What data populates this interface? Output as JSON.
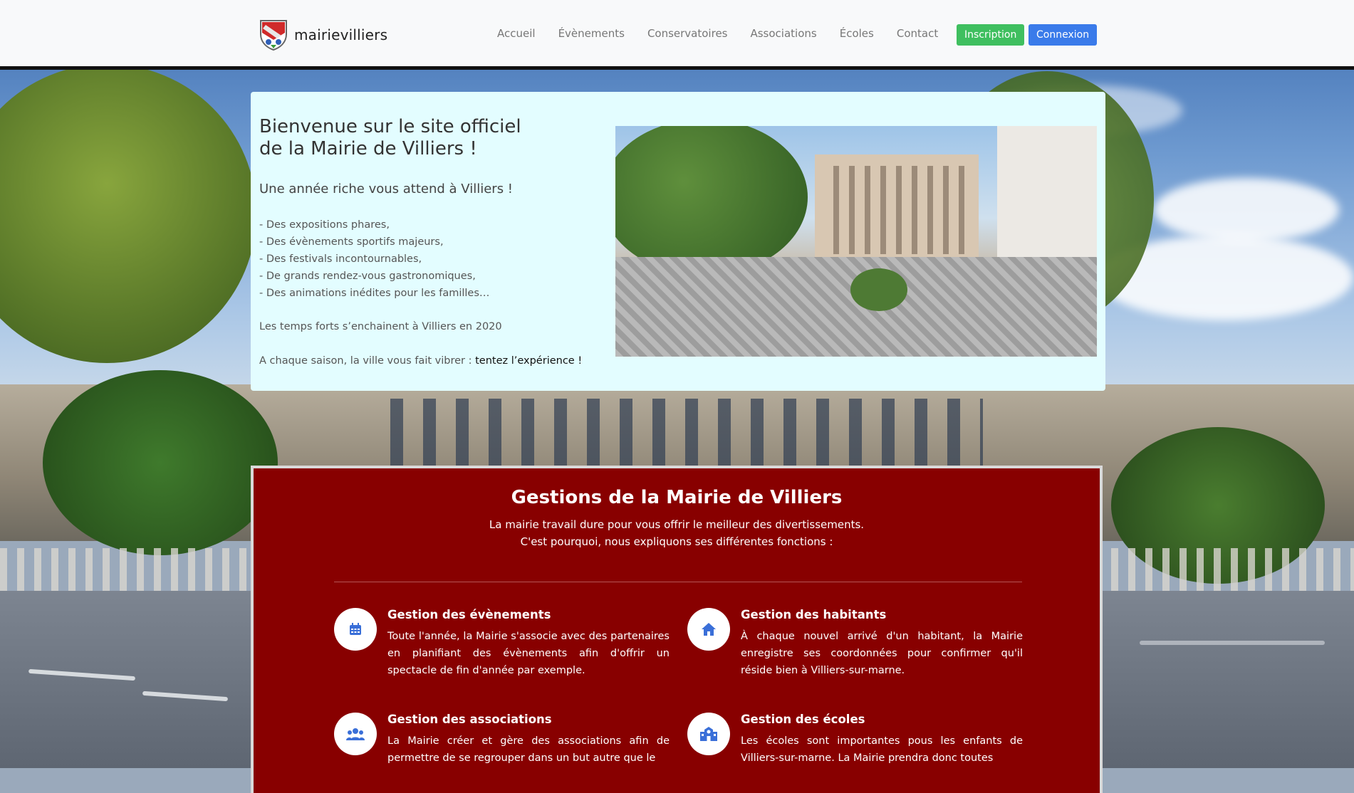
{
  "header": {
    "brand": "mairievilliers",
    "nav": [
      "Accueil",
      "Évènements",
      "Conservatoires",
      "Associations",
      "Écoles",
      "Contact"
    ],
    "btn_inscription": "Inscription",
    "btn_connexion": "Connexion"
  },
  "welcome": {
    "title_line1": "Bienvenue sur le site officiel",
    "title_line2": "de la Mairie de Villiers !",
    "lead": "Une année riche vous attend à Villiers !",
    "list": [
      "- Des expositions phares,",
      "- Des évènements sportifs majeurs,",
      "- Des festivals incontournables,",
      "- De grands rendez-vous gastronomiques,",
      "- Des animations inédites pour les familles…"
    ],
    "temps_forts": "Les temps forts s’enchainent à Villiers en 2020",
    "saison_text": "A chaque saison, la ville vous fait vibrer : ",
    "saison_link": "tentez l’expérience !"
  },
  "gestions": {
    "title": "Gestions de la Mairie de Villiers",
    "sub_line1": "La mairie travail dure pour vous offrir le meilleur des divertissements.",
    "sub_line2": "C'est pourquoi, nous expliquons ses différentes fonctions :",
    "features": [
      {
        "icon": "calendar-icon",
        "title": "Gestion des évènements",
        "text": "Toute l'année, la Mairie s'associe avec des partenaires en planifiant des évènements afin d'offrir un spectacle de fin d'année par exemple."
      },
      {
        "icon": "home-icon",
        "title": "Gestion des habitants",
        "text": "À chaque nouvel arrivé d'un habitant, la Mairie enregistre ses coordonnées pour confirmer qu'il réside bien à Villiers-sur-marne."
      },
      {
        "icon": "users-icon",
        "title": "Gestion des associations",
        "text": "La Mairie créer et gère des associations afin de permettre de se regrouper dans un but autre que le"
      },
      {
        "icon": "school-icon",
        "title": "Gestion des écoles",
        "text": "Les écoles sont importantes pous les enfants de Villiers-sur-marne. La Mairie prendra donc toutes"
      }
    ]
  },
  "colors": {
    "header_bg": "#f8f9fa",
    "welcome_bg": "#e3fdff",
    "gestions_bg": "#880000",
    "btn_green": "#3fbf5f",
    "btn_blue": "#3a7bea",
    "icon_blue": "#3a6fd8"
  }
}
